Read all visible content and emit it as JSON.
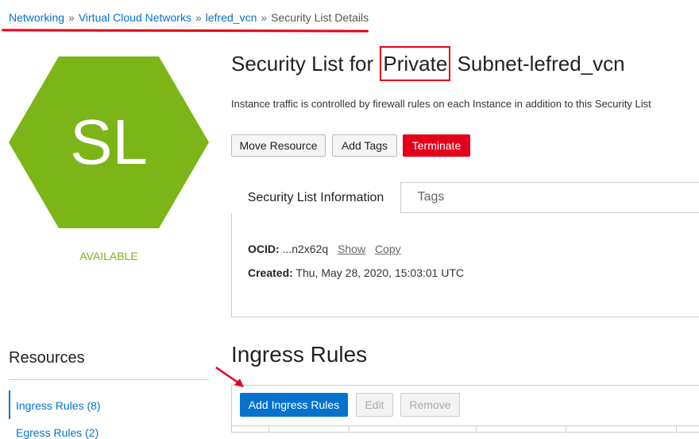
{
  "breadcrumb": {
    "items": [
      "Networking",
      "Virtual Cloud Networks",
      "lefred_vcn"
    ],
    "separator": "»",
    "current": "Security List Details"
  },
  "logo": {
    "initials": "SL",
    "color": "#7cb518"
  },
  "status": "AVAILABLE",
  "title": {
    "prefix": "Security List for",
    "highlight": "Private",
    "suffix": "Subnet-lefred_vcn"
  },
  "description": "Instance traffic is controlled by firewall rules on each Instance in addition to this Security List",
  "actions": {
    "move": "Move Resource",
    "tags": "Add Tags",
    "terminate": "Terminate"
  },
  "tabs": {
    "info": "Security List Information",
    "tags": "Tags"
  },
  "info": {
    "ocid_label": "OCID:",
    "ocid_value": "...n2x62q",
    "show": "Show",
    "copy": "Copy",
    "created_label": "Created:",
    "created_value": "Thu, May 28, 2020, 15:03:01 UTC"
  },
  "resources": {
    "title": "Resources",
    "items": [
      "Ingress Rules (8)",
      "Egress Rules (2)"
    ]
  },
  "ingress": {
    "title": "Ingress Rules",
    "add": "Add Ingress Rules",
    "edit": "Edit",
    "remove": "Remove"
  },
  "colors": {
    "accent": "#0572ce",
    "danger": "#e4001b",
    "status": "#7cb518"
  }
}
